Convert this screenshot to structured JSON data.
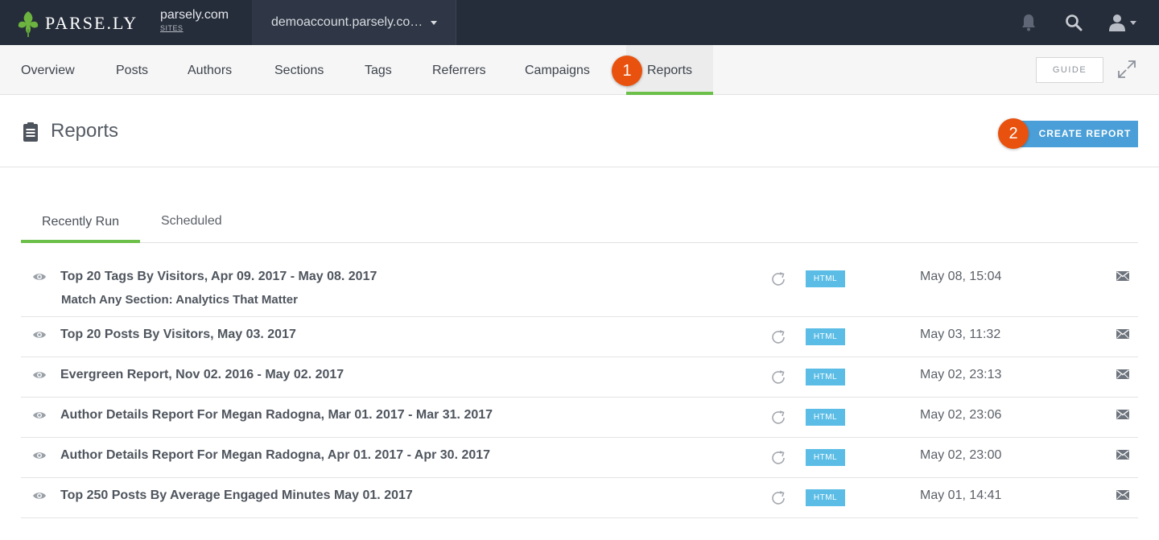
{
  "topbar": {
    "logo_text": "PARSE.LY",
    "site_name": "parsely.com",
    "site_sub": "SITES",
    "account": "demoaccount.parsely.co…"
  },
  "nav": {
    "items": [
      "Overview",
      "Posts",
      "Authors",
      "Sections",
      "Tags",
      "Referrers",
      "Campaigns",
      "Reports"
    ],
    "active": "Reports",
    "guide_label": "GUIDE"
  },
  "markers": [
    "1",
    "2"
  ],
  "page": {
    "title": "Reports",
    "create_label": "CREATE REPORT"
  },
  "tabs": {
    "recent": "Recently Run",
    "scheduled": "Scheduled"
  },
  "reports": [
    {
      "title": "Top 20 Tags By Visitors, Apr 09. 2017 - May 08. 2017",
      "subtitle": "Match Any Section: Analytics That Matter",
      "format": "HTML",
      "date": "May 08, 15:04"
    },
    {
      "title": "Top 20 Posts By Visitors, May 03. 2017",
      "subtitle": "",
      "format": "HTML",
      "date": "May 03, 11:32"
    },
    {
      "title": "Evergreen Report, Nov 02. 2016 - May 02. 2017",
      "subtitle": "",
      "format": "HTML",
      "date": "May 02, 23:13"
    },
    {
      "title": "Author Details Report For Megan Radogna, Mar 01. 2017 - Mar 31. 2017",
      "subtitle": "",
      "format": "HTML",
      "date": "May 02, 23:06"
    },
    {
      "title": "Author Details Report For Megan Radogna, Apr 01. 2017 - Apr 30. 2017",
      "subtitle": "",
      "format": "HTML",
      "date": "May 02, 23:00"
    },
    {
      "title": "Top 250 Posts By Average Engaged Minutes May 01. 2017",
      "subtitle": "",
      "format": "HTML",
      "date": "May 01, 14:41"
    }
  ],
  "colors": {
    "topbar": "#262d3a",
    "accent_green": "#6cc04a",
    "create_blue": "#4a9fd8",
    "html_badge": "#5bbde6",
    "marker_orange": "#e8520e"
  },
  "icons": [
    "parsely-leaf-icon",
    "caret-down-icon",
    "bell-icon",
    "search-icon",
    "user-icon",
    "expand-icon",
    "clipboard-icon",
    "eye-icon",
    "refresh-icon",
    "mail-icon"
  ]
}
